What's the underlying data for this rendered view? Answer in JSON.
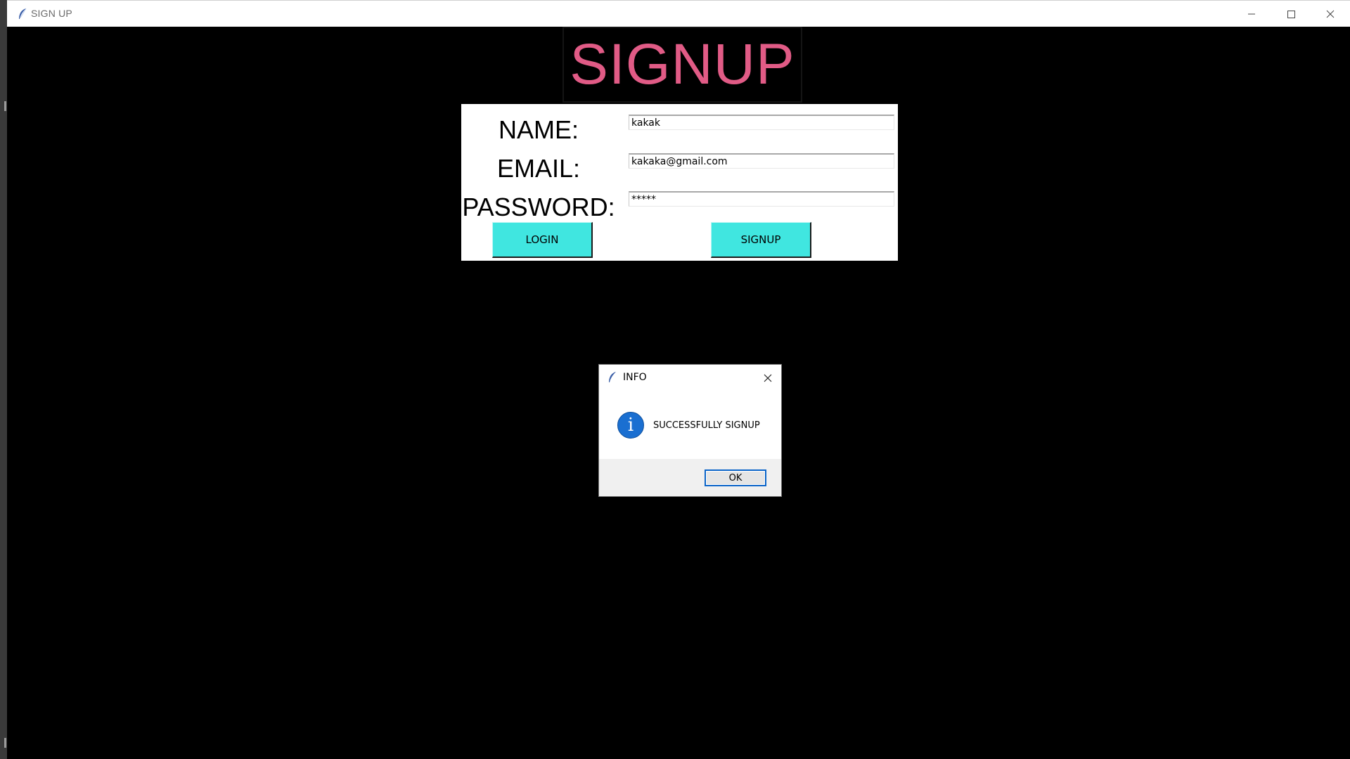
{
  "window": {
    "title": "SIGN UP",
    "icon": "feather-icon",
    "controls": [
      "minimize-icon",
      "maximize-icon",
      "close-icon"
    ]
  },
  "form": {
    "heading": "SIGNUP",
    "name_label": "NAME:",
    "name_value": "kakak",
    "email_label": "EMAIL:",
    "email_value": "kakaka@gmail.com",
    "password_label": "PASSWORD:",
    "password_value": "*****",
    "login_button": "LOGIN",
    "signup_button": "SIGNUP"
  },
  "dialog": {
    "title": "INFO",
    "message": "SUCCESSFULLY SIGNUP",
    "ok_button": "OK",
    "icon": "info-icon"
  },
  "colors": {
    "heading": "#e15b86",
    "button": "#40e6e0",
    "background": "#000000",
    "info_icon": "#1a6fd1"
  }
}
